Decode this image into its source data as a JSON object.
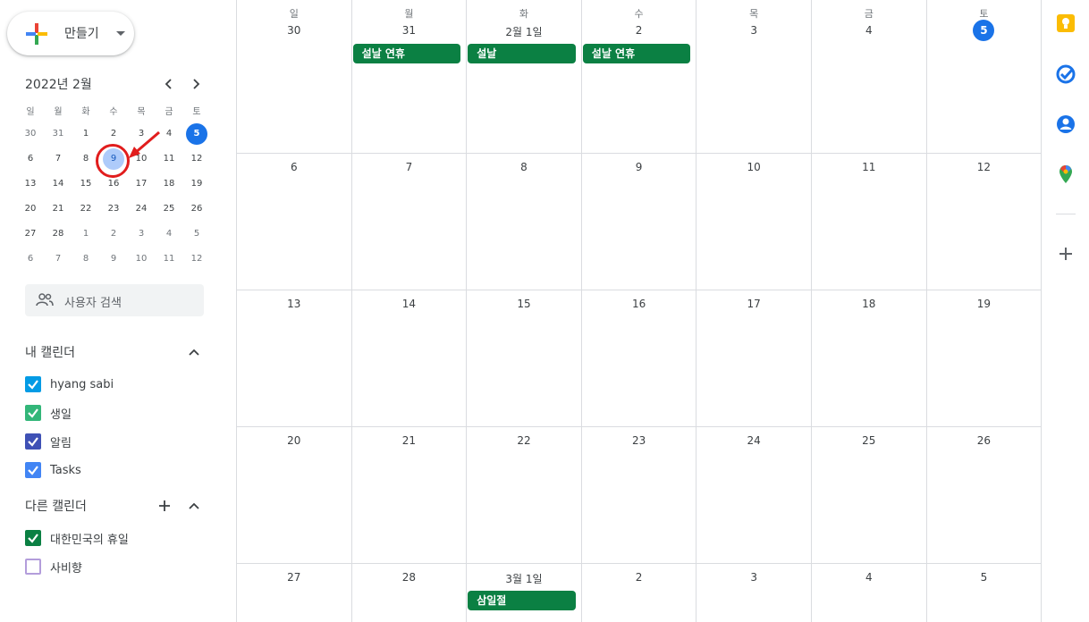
{
  "create_button": {
    "label": "만들기"
  },
  "mini_calendar": {
    "title": "2022년 2월",
    "weekdays": [
      "일",
      "월",
      "화",
      "수",
      "목",
      "금",
      "토"
    ],
    "weeks": [
      [
        [
          "30",
          true
        ],
        [
          "31",
          true
        ],
        [
          "1",
          false
        ],
        [
          "2",
          false
        ],
        [
          "3",
          false
        ],
        [
          "4",
          false
        ],
        [
          "5",
          false
        ]
      ],
      [
        [
          "6",
          false
        ],
        [
          "7",
          false
        ],
        [
          "8",
          false
        ],
        [
          "9",
          false
        ],
        [
          "10",
          false
        ],
        [
          "11",
          false
        ],
        [
          "12",
          false
        ]
      ],
      [
        [
          "13",
          false
        ],
        [
          "14",
          false
        ],
        [
          "15",
          false
        ],
        [
          "16",
          false
        ],
        [
          "17",
          false
        ],
        [
          "18",
          false
        ],
        [
          "19",
          false
        ]
      ],
      [
        [
          "20",
          false
        ],
        [
          "21",
          false
        ],
        [
          "22",
          false
        ],
        [
          "23",
          false
        ],
        [
          "24",
          false
        ],
        [
          "25",
          false
        ],
        [
          "26",
          false
        ]
      ],
      [
        [
          "27",
          false
        ],
        [
          "28",
          false
        ],
        [
          "1",
          true
        ],
        [
          "2",
          true
        ],
        [
          "3",
          true
        ],
        [
          "4",
          true
        ],
        [
          "5",
          true
        ]
      ],
      [
        [
          "6",
          true
        ],
        [
          "7",
          true
        ],
        [
          "8",
          true
        ],
        [
          "9",
          true
        ],
        [
          "10",
          true
        ],
        [
          "11",
          true
        ],
        [
          "12",
          true
        ]
      ]
    ],
    "today": "5",
    "selected": "9"
  },
  "search_people": {
    "label": "사용자 검색"
  },
  "my_calendars": {
    "title": "내 캘린더",
    "items": [
      {
        "name": "hyang sabi",
        "color": "#039be5",
        "checked": true
      },
      {
        "name": "생일",
        "color": "#33b679",
        "checked": true
      },
      {
        "name": "알림",
        "color": "#3f51b5",
        "checked": true
      },
      {
        "name": "Tasks",
        "color": "#4285f4",
        "checked": true
      }
    ]
  },
  "other_calendars": {
    "title": "다른 캘린더",
    "items": [
      {
        "name": "대한민국의 휴일",
        "color": "#0b8043",
        "checked": true
      },
      {
        "name": "사비향",
        "color": "#b39ddb",
        "checked": false
      }
    ]
  },
  "month_view": {
    "weekdays": [
      "일",
      "월",
      "화",
      "수",
      "목",
      "금",
      "토"
    ],
    "weeks": [
      [
        "30",
        "31",
        "2월 1일",
        "2",
        "3",
        "4",
        "5"
      ],
      [
        "6",
        "7",
        "8",
        "9",
        "10",
        "11",
        "12"
      ],
      [
        "13",
        "14",
        "15",
        "16",
        "17",
        "18",
        "19"
      ],
      [
        "20",
        "21",
        "22",
        "23",
        "24",
        "25",
        "26"
      ],
      [
        "27",
        "28",
        "3월 1일",
        "2",
        "3",
        "4",
        "5"
      ]
    ],
    "today_label": "5",
    "events": [
      {
        "title": "설날 연휴",
        "week": 0,
        "day": 1
      },
      {
        "title": "설날",
        "week": 0,
        "day": 2
      },
      {
        "title": "설날 연휴",
        "week": 0,
        "day": 3
      },
      {
        "title": "삼일절",
        "week": 4,
        "day": 2
      }
    ],
    "event_color": "#0b8043"
  },
  "side_panel": {
    "icons": [
      "keep-icon",
      "tasks-icon",
      "contacts-icon",
      "maps-icon",
      "add-addon-icon"
    ]
  }
}
